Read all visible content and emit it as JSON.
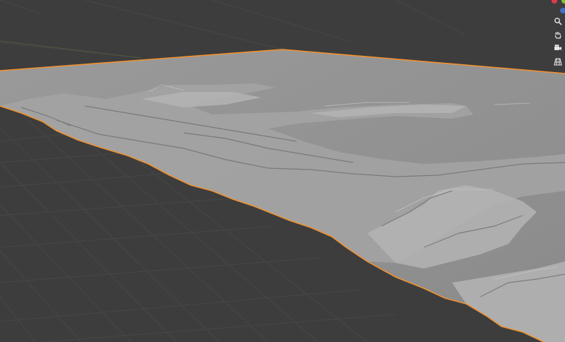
{
  "viewport": {
    "background": "#3d3d3d",
    "grid_color": "#474747",
    "selection_outline_color": "#f0922f",
    "terrain_flat_color": "#8c8c8c",
    "terrain_relief_color": "#9d9d9d"
  },
  "gizmo": {
    "x_axis_color": "#e3394f",
    "y_axis_color": "#7ac52c",
    "z_axis_color": "#3d72c8"
  },
  "navigation": {
    "buttons": [
      {
        "name": "zoom",
        "icon": "magnifier-icon"
      },
      {
        "name": "pan",
        "icon": "hand-icon"
      },
      {
        "name": "camera",
        "icon": "camera-icon"
      },
      {
        "name": "projection",
        "icon": "grid-perspective-icon"
      }
    ]
  }
}
